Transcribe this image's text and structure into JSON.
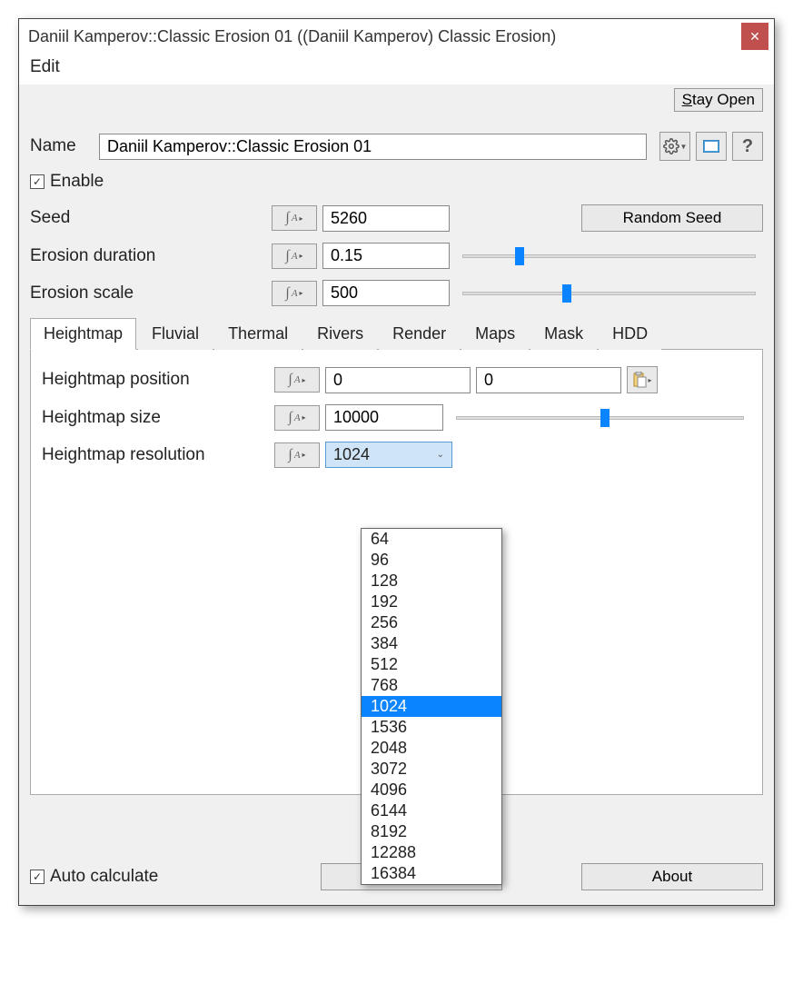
{
  "title": "Daniil Kamperov::Classic Erosion 01    ((Daniil Kamperov) Classic Erosion)",
  "menu": {
    "edit": "Edit"
  },
  "stay_open": "Stay Open",
  "name_label": "Name",
  "name_value": "Daniil Kamperov::Classic Erosion 01",
  "enable_label": "Enable",
  "enable_checked": true,
  "seed": {
    "label": "Seed",
    "value": "5260",
    "random_btn": "Random Seed"
  },
  "erosion_duration": {
    "label": "Erosion duration",
    "value": "0.15",
    "slider_pct": 18
  },
  "erosion_scale": {
    "label": "Erosion scale",
    "value": "500",
    "slider_pct": 34
  },
  "tabs": [
    "Heightmap",
    "Fluvial",
    "Thermal",
    "Rivers",
    "Render",
    "Maps",
    "Mask",
    "HDD"
  ],
  "active_tab": 0,
  "heightmap": {
    "position_label": "Heightmap position",
    "position_x": "0",
    "position_y": "0",
    "size_label": "Heightmap size",
    "size_value": "10000",
    "size_slider_pct": 50,
    "resolution_label": "Heightmap resolution",
    "resolution_value": "1024",
    "resolution_options": [
      "64",
      "96",
      "128",
      "192",
      "256",
      "384",
      "512",
      "768",
      "1024",
      "1536",
      "2048",
      "3072",
      "4096",
      "6144",
      "8192",
      "12288",
      "16384"
    ]
  },
  "auto_calculate_label": "Auto calculate",
  "auto_calculate_checked": true,
  "about_btn": "About",
  "icons": {
    "gear": "gear-icon",
    "viewport": "viewport-icon",
    "help": "help-icon",
    "paste": "clipboard-icon",
    "close": "close-icon"
  }
}
